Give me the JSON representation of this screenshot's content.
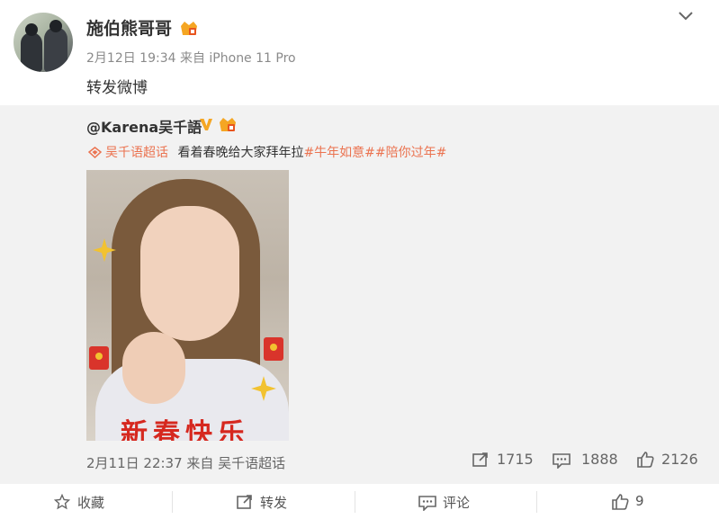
{
  "post": {
    "author": "施伯熊哥哥",
    "meta": "2月12日 19:34 来自 iPhone 11 Pro",
    "text": "转发微博"
  },
  "retweet": {
    "author": "@Karena吴千語",
    "supertopic": "吴千语超话",
    "text_plain": "看着春晚给大家拜年拉",
    "hashtags": "#牛年如意##陪你过年#",
    "photo_caption": "新春快乐",
    "footer_meta": "2月11日 22:37 来自 吴千语超话",
    "reposts": "1715",
    "comments": "1888",
    "likes": "2126"
  },
  "actions": {
    "favorite": "收藏",
    "repost": "转发",
    "comment": "评论",
    "like_count": "9"
  },
  "colors": {
    "link": "#eb7350",
    "verified": "#f5a623",
    "retweet_bg": "#f2f2f2"
  }
}
